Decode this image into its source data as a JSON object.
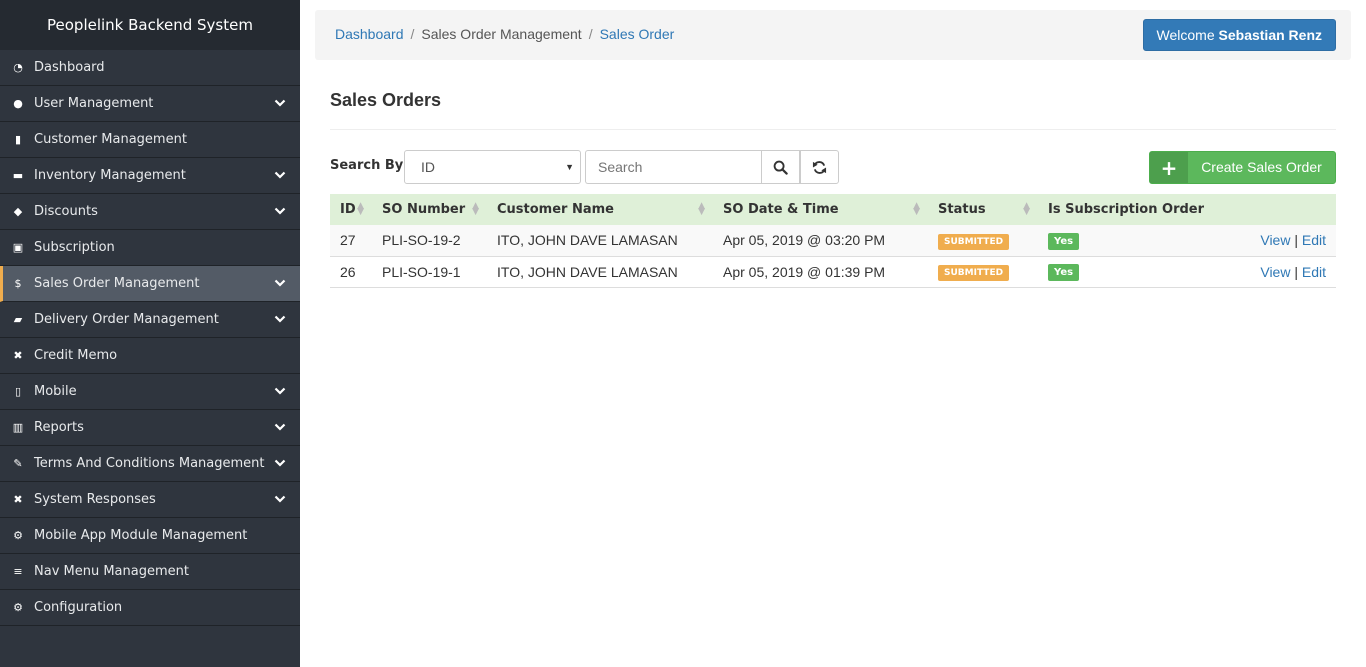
{
  "app": {
    "title": "Peoplelink Backend System"
  },
  "sidebar": {
    "items": [
      {
        "label": "Dashboard",
        "icon": "dashboard-icon",
        "glyph": "◔",
        "has_children": false,
        "active": false
      },
      {
        "label": "User Management",
        "icon": "user-icon",
        "glyph": "●",
        "has_children": true,
        "active": false
      },
      {
        "label": "Customer Management",
        "icon": "id-card-icon",
        "glyph": "▮",
        "has_children": false,
        "active": false
      },
      {
        "label": "Inventory Management",
        "icon": "folder-icon",
        "glyph": "▬",
        "has_children": true,
        "active": false
      },
      {
        "label": "Discounts",
        "icon": "tags-icon",
        "glyph": "◆",
        "has_children": true,
        "active": false
      },
      {
        "label": "Subscription",
        "icon": "rss-icon",
        "glyph": "▣",
        "has_children": false,
        "active": false
      },
      {
        "label": "Sales Order Management",
        "icon": "dollar-icon",
        "glyph": "$",
        "has_children": true,
        "active": true
      },
      {
        "label": "Delivery Order Management",
        "icon": "truck-icon",
        "glyph": "▰",
        "has_children": true,
        "active": false
      },
      {
        "label": "Credit Memo",
        "icon": "close-icon",
        "glyph": "✖",
        "has_children": false,
        "active": false
      },
      {
        "label": "Mobile",
        "icon": "mobile-icon",
        "glyph": "▯",
        "has_children": true,
        "active": false
      },
      {
        "label": "Reports",
        "icon": "bar-chart-icon",
        "glyph": "▥",
        "has_children": true,
        "active": false
      },
      {
        "label": "Terms And Conditions Management",
        "icon": "edit-icon",
        "glyph": "✎",
        "has_children": true,
        "active": false
      },
      {
        "label": "System Responses",
        "icon": "close-icon",
        "glyph": "✖",
        "has_children": true,
        "active": false
      },
      {
        "label": "Mobile App Module Management",
        "icon": "cogs-icon",
        "glyph": "⚙",
        "has_children": false,
        "active": false
      },
      {
        "label": "Nav Menu Management",
        "icon": "bars-icon",
        "glyph": "≡",
        "has_children": false,
        "active": false
      },
      {
        "label": "Configuration",
        "icon": "cogs-icon",
        "glyph": "⚙",
        "has_children": false,
        "active": false
      }
    ]
  },
  "header": {
    "breadcrumb": {
      "home": "Dashboard",
      "section": "Sales Order Management",
      "current": "Sales Order"
    },
    "welcome_prefix": "Welcome",
    "user_name": "Sebastian Renz"
  },
  "page": {
    "title": "Sales Orders"
  },
  "search": {
    "label": "Search By",
    "selected_field": "ID",
    "placeholder": "Search",
    "search_icon": "search-icon",
    "refresh_icon": "refresh-icon"
  },
  "create_button": {
    "label": "Create Sales Order",
    "icon": "plus-icon"
  },
  "table": {
    "columns": [
      "ID",
      "SO Number",
      "Customer Name",
      "SO Date & Time",
      "Status",
      "Is Subscription Order"
    ],
    "rows": [
      {
        "id": "27",
        "so_number": "PLI-SO-19-2",
        "customer": "ITO, JOHN DAVE LAMASAN",
        "date": "Apr 05, 2019 @ 03:20 PM",
        "status": "SUBMITTED",
        "subscription": "Yes",
        "view": "View",
        "sep": "|",
        "edit": "Edit"
      },
      {
        "id": "26",
        "so_number": "PLI-SO-19-1",
        "customer": "ITO, JOHN DAVE LAMASAN",
        "date": "Apr 05, 2019 @ 01:39 PM",
        "status": "SUBMITTED",
        "subscription": "Yes",
        "view": "View",
        "sep": "|",
        "edit": "Edit"
      }
    ]
  },
  "colors": {
    "sidebar_bg": "#2f353e",
    "active_accent": "#f0ad4e",
    "primary": "#337ab7",
    "success": "#5cb85c",
    "table_header_bg": "#dff0d8"
  }
}
